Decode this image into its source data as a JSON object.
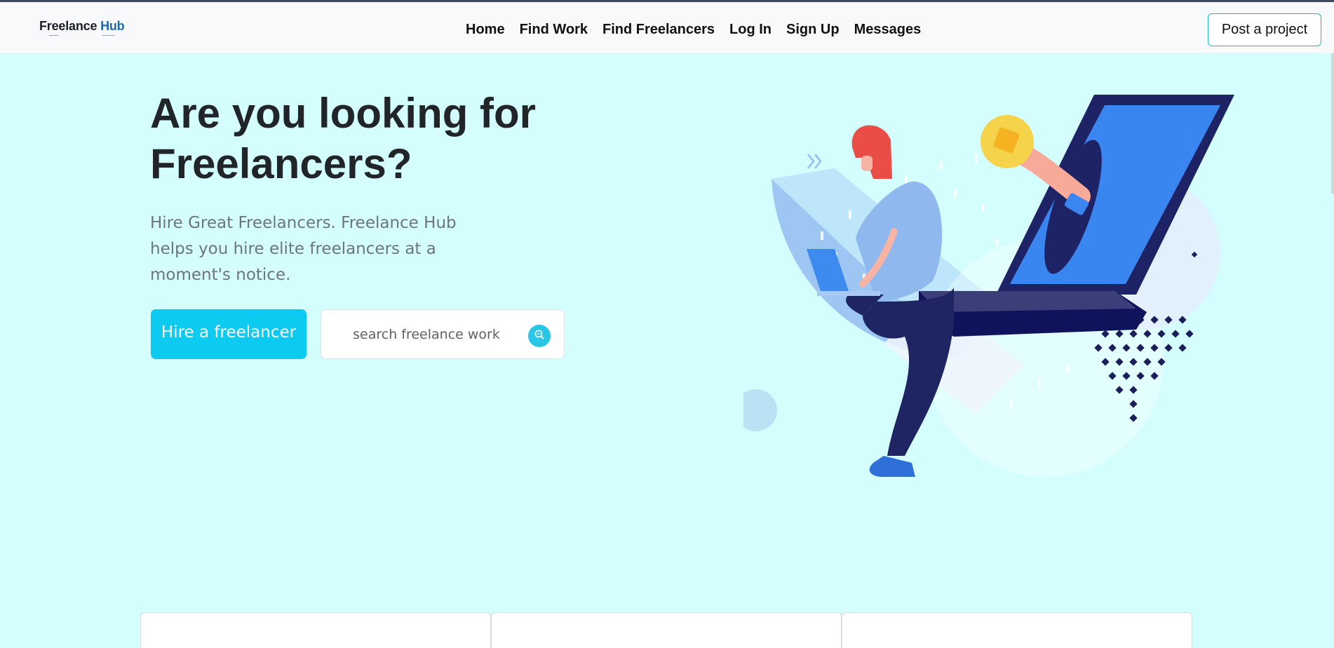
{
  "brand": {
    "name_first": "Freelance",
    "name_second": "Hub"
  },
  "nav": {
    "links": [
      "Home",
      "Find Work",
      "Find Freelancers",
      "Log In",
      "Sign Up",
      "Messages"
    ],
    "post_project": "Post a project"
  },
  "hero": {
    "title": "Are you looking for Freelancers?",
    "subtitle": "Hire Great Freelancers. Freelance Hub helps you hire elite freelancers at a moment's notice.",
    "hire_button": "Hire a freelancer",
    "search_placeholder": "search freelance work"
  },
  "colors": {
    "background": "#d4fefe",
    "accent": "#0dcaf0",
    "heading": "#212529",
    "muted": "#6c757d"
  },
  "icons": {
    "search": "search-icon"
  }
}
